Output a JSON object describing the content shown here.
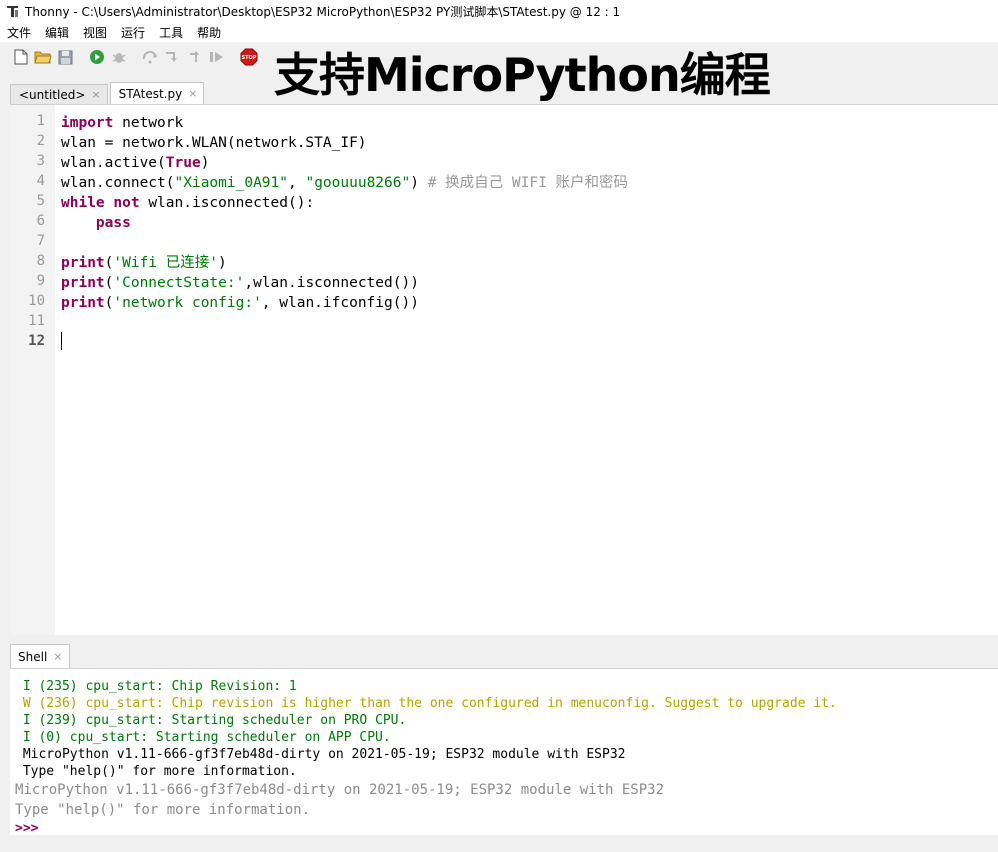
{
  "window": {
    "app_name": "Thonny",
    "title": "Thonny  -  C:\\Users\\Administrator\\Desktop\\ESP32 MicroPython\\ESP32 PY测试脚本\\STAtest.py  @  12 : 1"
  },
  "menu": [
    "文件",
    "编辑",
    "视图",
    "运行",
    "工具",
    "帮助"
  ],
  "toolbar_icons": [
    "new-file-icon",
    "open-file-icon",
    "save-icon",
    "run-icon",
    "debug-icon",
    "step-over-icon",
    "step-into-icon",
    "step-out-icon",
    "resume-icon",
    "stop-icon"
  ],
  "stop_label": "STOP",
  "banner": "支持MicroPython编程",
  "editor": {
    "tabs": [
      {
        "label": "<untitled>",
        "close": "×"
      },
      {
        "label": "STAtest.py",
        "close": "×"
      }
    ],
    "line_numbers": [
      "1",
      "2",
      "3",
      "4",
      "5",
      "6",
      "7",
      "8",
      "9",
      "10",
      "11",
      "12"
    ],
    "current_line": "12"
  },
  "code": {
    "l1_kw": "import",
    "l1_rest": " network",
    "l2": "wlan = network.WLAN(network.STA_IF)",
    "l3_a": "wlan.active(",
    "l3_kw": "True",
    "l3_b": ")",
    "l4_a": "wlan.connect(",
    "l4_s1": "\"Xiaomi_0A91\"",
    "l4_b": ", ",
    "l4_s2": "\"goouuu8266\"",
    "l4_c": ") ",
    "l4_cmt": "# 换成自己 WIFI 账户和密码",
    "l5_kw1": "while",
    "l5_sp": " ",
    "l5_kw2": "not",
    "l5_rest": " wlan.isconnected():",
    "l6_indent": "    ",
    "l6_kw": "pass",
    "l8_kw": "print",
    "l8_a": "(",
    "l8_s": "'Wifi 已连接'",
    "l8_b": ")",
    "l9_kw": "print",
    "l9_a": "(",
    "l9_s": "'ConnectState:'",
    "l9_b": ",wlan.isconnected())",
    "l10_kw": "print",
    "l10_a": "(",
    "l10_s": "'network config:'",
    "l10_b": ", wlan.ifconfig())"
  },
  "shell": {
    "tab_label": "Shell",
    "tab_close": "×",
    "lines": [
      {
        "text": " I (235) cpu_start: Chip Revision: 1",
        "kind": "info"
      },
      {
        "text": " W (236) cpu_start: Chip revision is higher than the one configured in menuconfig. Suggest to upgrade it.",
        "kind": "warn"
      },
      {
        "text": " I (239) cpu_start: Starting scheduler on PRO CPU.",
        "kind": "info"
      },
      {
        "text": " I (0) cpu_start: Starting scheduler on APP CPU.",
        "kind": "info"
      },
      {
        "text": " MicroPython v1.11-666-gf3f7eb48d-dirty on 2021-05-19; ESP32 module with ESP32",
        "kind": "out"
      },
      {
        "text": " Type \"help()\" for more information.",
        "kind": "out"
      }
    ],
    "banner_line1": "MicroPython v1.11-666-gf3f7eb48d-dirty on 2021-05-19; ESP32 module with ESP32",
    "banner_line2": "Type \"help()\" for more information.",
    "prompt": ">>>"
  },
  "colors": {
    "keyword": "#8a0057",
    "string": "#00770b",
    "comment": "#999999",
    "warning": "#b5a300"
  }
}
